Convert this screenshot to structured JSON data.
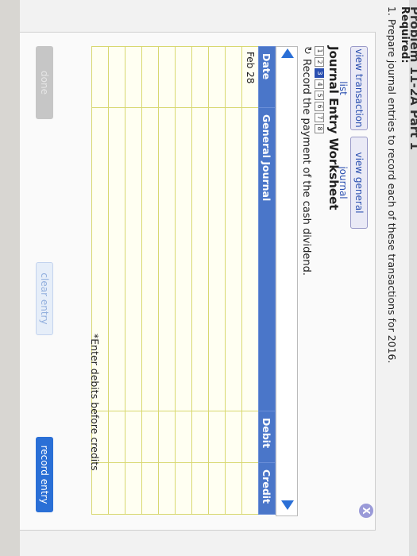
{
  "header": {
    "problem_title": "Problem 11-2A Part 1",
    "required_label": "Required:",
    "required_text": "1. Prepare journal entries to record each of these transactions for 2016."
  },
  "buttons": {
    "view_transaction_list": "view transaction list",
    "view_general_journal": "view general journal",
    "done": "done",
    "clear_entry": "clear entry",
    "record_entry": "record entry",
    "close": "X"
  },
  "worksheet": {
    "title": "Journal Entry Worksheet",
    "steps": [
      "1",
      "2",
      "3",
      "4",
      "5",
      "6",
      "7",
      "8"
    ],
    "active_step": "3",
    "instruction": "Record the payment of the cash dividend."
  },
  "table": {
    "headers": {
      "date": "Date",
      "general_journal": "General Journal",
      "debit": "Debit",
      "credit": "Credit"
    },
    "rows": [
      {
        "date": "Feb 28",
        "account": "",
        "debit": "",
        "credit": ""
      },
      {
        "date": "",
        "account": "",
        "debit": "",
        "credit": ""
      },
      {
        "date": "",
        "account": "",
        "debit": "",
        "credit": ""
      },
      {
        "date": "",
        "account": "",
        "debit": "",
        "credit": ""
      },
      {
        "date": "",
        "account": "",
        "debit": "",
        "credit": ""
      },
      {
        "date": "",
        "account": "",
        "debit": "",
        "credit": ""
      },
      {
        "date": "",
        "account": "",
        "debit": "",
        "credit": ""
      },
      {
        "date": "",
        "account": "",
        "debit": "",
        "credit": ""
      },
      {
        "date": "",
        "account": "",
        "debit": "",
        "credit": ""
      },
      {
        "date": "",
        "account": "",
        "debit": "",
        "credit": ""
      }
    ]
  },
  "note": "*Enter debits before credits",
  "colors": {
    "accent": "#2a6fd6",
    "header_blue": "#4a76c9",
    "cell_border": "#d8d870"
  }
}
